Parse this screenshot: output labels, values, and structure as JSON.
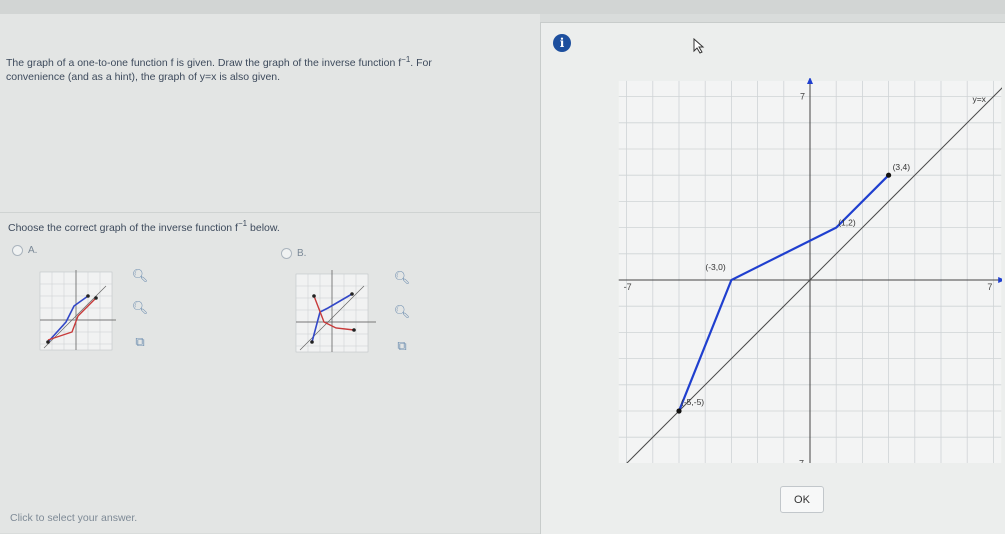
{
  "question": {
    "line1_part1": "The graph of a one-to-one function f is given. Draw the graph of the inverse function f",
    "line1_sup": "−1",
    "line1_part2": ". For",
    "line2": "convenience (and as a hint), the graph of y=x is also given."
  },
  "prompt": {
    "part1": "Choose the correct graph of the inverse function f",
    "sup": "−1",
    "part2": " below."
  },
  "options": [
    {
      "letter": "A."
    },
    {
      "letter": "B."
    }
  ],
  "footer": "Click to select your answer.",
  "popup": {
    "ok_label": "OK",
    "info_icon": "i"
  },
  "chart_data": {
    "type": "line",
    "xlim": [
      -7,
      7
    ],
    "ylim": [
      -7,
      7
    ],
    "x_tick_labels": [
      "-7",
      "7"
    ],
    "y_tick_labels": [
      "7",
      "-7"
    ],
    "grid": true,
    "series": [
      {
        "name": "y=x",
        "x": [
          -7.5,
          7.5
        ],
        "y": [
          -7.5,
          7.5
        ],
        "color": "#4a4a4a"
      },
      {
        "x": [
          -5,
          -3,
          1,
          3
        ],
        "y": [
          -5,
          0,
          2,
          4
        ],
        "color": "#1f3fcf"
      }
    ],
    "point_labels": [
      {
        "text": "(-5,-5)",
        "x": -5,
        "y": -5
      },
      {
        "text": "(-3,0)",
        "x": -3,
        "y": 0
      },
      {
        "text": "(1,2)",
        "x": 1,
        "y": 2
      },
      {
        "text": "(3,4)",
        "x": 3,
        "y": 4
      }
    ],
    "line_label": "y=x"
  }
}
